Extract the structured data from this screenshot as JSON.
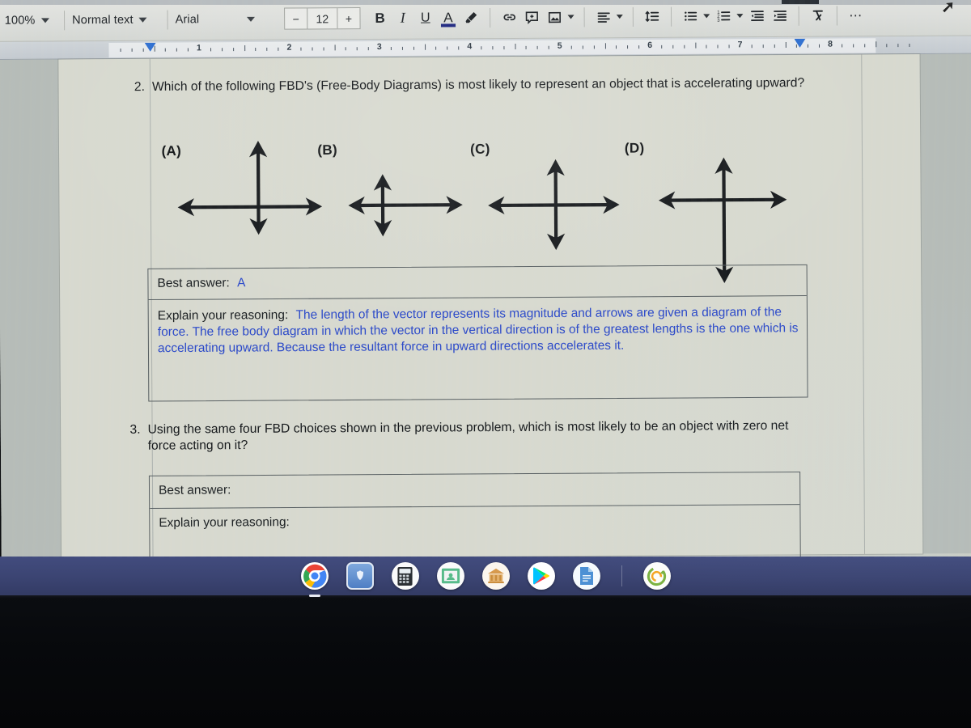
{
  "app": {
    "name": "Google Docs",
    "platform": "ChromeOS"
  },
  "toolbar": {
    "zoom_level": "100%",
    "paragraph_style": "Normal text",
    "font_family": "Arial",
    "font_size": "12",
    "font_size_decrease": "−",
    "font_size_increase": "+",
    "bold_label": "B",
    "italic_label": "I",
    "underline_label": "U",
    "text_color_label": "A",
    "highlight_icon": "highlighter-icon",
    "insert_link_icon": "link-icon",
    "add_comment_icon": "add-comment-icon",
    "insert_image_icon": "insert-image-icon",
    "align_icon": "align-icon",
    "line_spacing_icon": "line-spacing-icon",
    "bulleted_list_icon": "bulleted-list-icon",
    "numbered_list_icon": "numbered-list-icon",
    "decrease_indent_icon": "decrease-indent-icon",
    "increase_indent_icon": "increase-indent-icon",
    "clear_formatting_icon": "clear-formatting-icon",
    "more_options_label": "⋯",
    "accent_color": "#1a237e"
  },
  "ruler": {
    "numbers": [
      "1",
      "2",
      "3",
      "4",
      "5",
      "6",
      "7",
      "8"
    ],
    "left_indent_marker": "indent-marker",
    "right_indent_marker": "indent-marker"
  },
  "document": {
    "questions": [
      {
        "number": "2.",
        "text": "Which of the following FBD's (Free-Body Diagrams) is most likely to represent an object that is accelerating upward?",
        "answer_box": {
          "best_answer_label": "Best answer:",
          "best_answer_value": "A",
          "reasoning_label": "Explain your reasoning:",
          "reasoning_value": "The length of the vector represents its magnitude and arrows are given a diagram of the force. The free body diagram in which the vector in the vertical direction is of the greatest lengths is the one which is accelerating upward. Because the resultant force in upward directions accelerates it.",
          "answer_color": "#2b49c9"
        }
      },
      {
        "number": "3.",
        "text": "Using the same four FBD choices shown in the previous problem, which is most likely to be an object with zero net force acting on it?",
        "answer_box": {
          "best_answer_label": "Best answer:",
          "best_answer_value": "",
          "reasoning_label": "Explain your reasoning:",
          "reasoning_value": "",
          "answer_color": "#2b49c9"
        }
      }
    ],
    "fbd_choices": [
      {
        "label": "(A)",
        "up_length": 73,
        "down_length": 28,
        "left_length": 86,
        "right_length": 70,
        "description": "long upward arrow, short downward arrow, roughly equal horizontal arrows"
      },
      {
        "label": "(B)",
        "up_length": 33,
        "down_length": 33,
        "left_length": 33,
        "right_length": 93,
        "description": "equal short vertical arrows, long rightward horizontal arrow"
      },
      {
        "label": "(C)",
        "up_length": 47,
        "down_length": 48,
        "left_length": 72,
        "right_length": 68,
        "description": "equal vertical arrows and equal horizontal arrows"
      },
      {
        "label": "(D)",
        "up_length": 42,
        "down_length": 92,
        "left_length": 68,
        "right_length": 65,
        "description": "short upward arrow, long downward arrow, equal horizontal arrows"
      }
    ]
  },
  "shelf": {
    "apps": [
      {
        "name": "chrome-app-icon",
        "active": true
      },
      {
        "name": "blue-app-icon",
        "active": false
      },
      {
        "name": "calculator-app-icon",
        "active": false
      },
      {
        "name": "google-classroom-app-icon",
        "active": false
      },
      {
        "name": "bank-app-icon",
        "active": false
      },
      {
        "name": "play-store-app-icon",
        "active": false
      },
      {
        "name": "google-docs-app-icon",
        "active": false
      },
      {
        "name": "recovery-app-icon",
        "active": false
      }
    ]
  }
}
